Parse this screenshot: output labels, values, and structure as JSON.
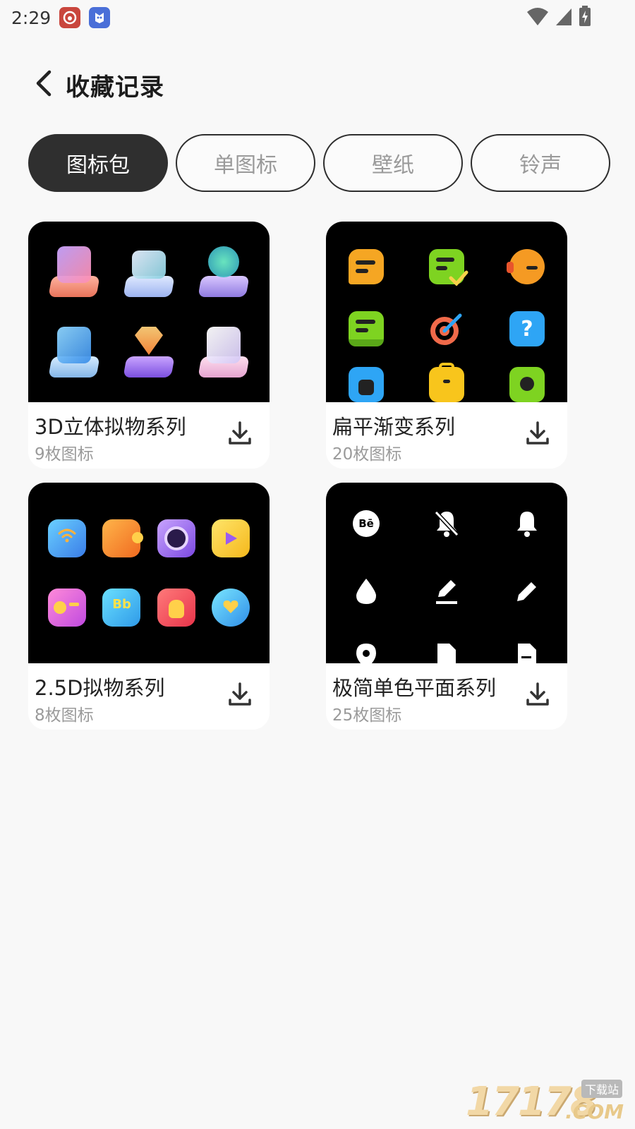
{
  "status_bar": {
    "time": "2:29"
  },
  "header": {
    "title": "收藏记录"
  },
  "tabs": [
    {
      "label": "图标包",
      "active": true
    },
    {
      "label": "单图标",
      "active": false
    },
    {
      "label": "壁纸",
      "active": false
    },
    {
      "label": "铃声",
      "active": false
    }
  ],
  "cards": [
    {
      "title": "3D立体拟物系列",
      "count": "9枚图标"
    },
    {
      "title": "扁平渐变系列",
      "count": "20枚图标"
    },
    {
      "title": "2.5D拟物系列",
      "count": "8枚图标"
    },
    {
      "title": "极简单色平面系列",
      "count": "25枚图标"
    }
  ],
  "mono_badge": "Bē",
  "watermark": {
    "number": "17178",
    "tag": "下载站",
    "suffix": ".COM"
  },
  "colors": {
    "tab_active_bg": "#2f2f2f",
    "tab_border": "#2e2e2e",
    "accent_orange": "#f5a623",
    "flat_green": "#7ed321",
    "flat_blue": "#2ea5f5"
  }
}
